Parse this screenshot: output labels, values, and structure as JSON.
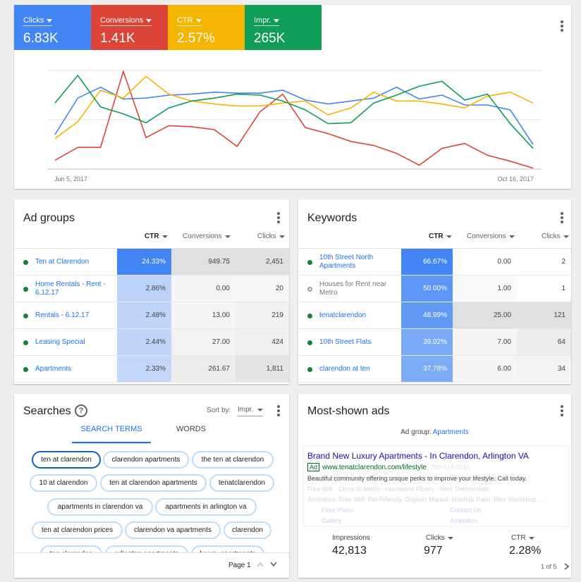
{
  "summary": {
    "metrics": [
      {
        "label": "Clicks",
        "value": "6.83K",
        "color": "#4285f4"
      },
      {
        "label": "Conversions",
        "value": "1.41K",
        "color": "#db4437"
      },
      {
        "label": "CTR",
        "value": "2.57%",
        "color": "#f4b400"
      },
      {
        "label": "Impr.",
        "value": "265K",
        "color": "#0f9d58"
      }
    ],
    "x_start": "Jun 5, 2017",
    "x_end": "Oct 16, 2017"
  },
  "chart_data": {
    "type": "line",
    "x": [
      "Jun 5, 2017",
      "",
      "",
      "",
      "",
      "",
      "",
      "",
      "",
      "",
      "",
      "",
      "",
      "",
      "",
      "",
      "",
      "",
      "",
      "",
      "",
      "Oct 16, 2017"
    ],
    "xlabel": "",
    "ylabel": "",
    "grid": true,
    "legend": "top (metric tiles)",
    "series": [
      {
        "name": "Clicks",
        "color": "#4285f4",
        "values": [
          0.35,
          0.72,
          0.83,
          0.71,
          0.72,
          0.75,
          0.76,
          0.78,
          0.77,
          0.77,
          0.8,
          0.7,
          0.66,
          0.69,
          0.72,
          0.83,
          0.71,
          0.75,
          0.65,
          0.65,
          0.6,
          0.25
        ]
      },
      {
        "name": "Conversions",
        "color": "#db4437",
        "values": [
          0.09,
          0.22,
          0.22,
          0.99,
          0.32,
          0.44,
          0.43,
          0.4,
          0.23,
          0.58,
          0.76,
          0.42,
          0.36,
          0.28,
          0.24,
          0.16,
          0.04,
          0.21,
          0.26,
          0.14,
          0.08,
          0.01
        ]
      },
      {
        "name": "CTR",
        "color": "#f4b400",
        "values": [
          0.31,
          0.48,
          0.8,
          0.72,
          0.94,
          0.76,
          0.69,
          0.66,
          0.64,
          0.64,
          0.67,
          0.69,
          0.55,
          0.62,
          0.78,
          0.69,
          0.69,
          0.66,
          0.62,
          0.74,
          0.78,
          0.67
        ]
      },
      {
        "name": "Impr.",
        "color": "#0f9d58",
        "values": [
          0.67,
          0.95,
          0.63,
          0.56,
          0.47,
          0.62,
          0.69,
          0.72,
          0.76,
          0.75,
          0.69,
          0.6,
          0.46,
          0.47,
          0.67,
          0.75,
          0.84,
          0.89,
          0.7,
          0.76,
          0.46,
          0.21
        ]
      }
    ]
  },
  "ad_groups": {
    "title": "Ad groups",
    "headers": {
      "ctr": "CTR",
      "conversions": "Conversions",
      "clicks": "Clicks"
    },
    "rows": [
      {
        "name": "Ten at Clarendon",
        "ctr": "24.33%",
        "conversions": "949.75",
        "clicks": "2,451",
        "status": "enabled"
      },
      {
        "name": "Home Rentals - Rent - 6.12.17",
        "ctr": "2.86%",
        "conversions": "0.00",
        "clicks": "20",
        "status": "enabled"
      },
      {
        "name": "Rentals - 6.12.17",
        "ctr": "2.48%",
        "conversions": "13.00",
        "clicks": "219",
        "status": "enabled"
      },
      {
        "name": "Leasing Special",
        "ctr": "2.44%",
        "conversions": "27.00",
        "clicks": "424",
        "status": "enabled"
      },
      {
        "name": "Apartments",
        "ctr": "2.33%",
        "conversions": "261.67",
        "clicks": "1,811",
        "status": "enabled"
      }
    ]
  },
  "keywords": {
    "title": "Keywords",
    "headers": {
      "ctr": "CTR",
      "conversions": "Conversions",
      "clicks": "Clicks"
    },
    "rows": [
      {
        "name": "10th Street North Apartments",
        "ctr": "66.67%",
        "conversions": "0.00",
        "clicks": "2",
        "status": "enabled"
      },
      {
        "name": "Houses for Rent near Metro",
        "ctr": "50.00%",
        "conversions": "1.00",
        "clicks": "1",
        "status": "paused"
      },
      {
        "name": "tenatclarendon",
        "ctr": "48.99%",
        "conversions": "25.00",
        "clicks": "121",
        "status": "enabled"
      },
      {
        "name": "10th Street Flats",
        "ctr": "39.02%",
        "conversions": "7.00",
        "clicks": "64",
        "status": "enabled"
      },
      {
        "name": "clarendon at ten",
        "ctr": "37.78%",
        "conversions": "6.00",
        "clicks": "34",
        "status": "enabled"
      }
    ]
  },
  "searches": {
    "title": "Searches",
    "help_icon": "?",
    "sort_label": "Sort by:",
    "sort_value": "Impr.",
    "tabs": [
      "SEARCH TERMS",
      "WORDS"
    ],
    "chips": [
      "ten at clarendon",
      "clarendon apartments",
      "the ten at clarendon",
      "10 at clarendon",
      "ten at clarendon apartments",
      "tenatclarendon",
      "apartments in clarendon va",
      "apartments in arlington va",
      "ten at clarendon prices",
      "clarendon va apartments",
      "clarendon",
      "ten clarendon",
      "arlington apartments",
      "luxury apartments"
    ],
    "page_label": "Page 1"
  },
  "ads": {
    "title": "Most-shown ads",
    "ad_group_label": "Ad group:",
    "ad_group_value": "Apartments",
    "headline": "Brand New Luxury Apartments - In Clarendon, Arlington VA",
    "ad_badge": "Ad",
    "url": "www.tenatclarendon.com/lifestyle",
    "phone": "703-516-0010",
    "description": "Beautiful community offering unique perks to improve your lifestyle. Call today.",
    "line2": "Free Wifi · Close to Metro · Hardwood Floors · Nest Thermostats",
    "line3": "Amenities: Free Wifi, Pet-Friendly, Organic Market, Rooftop Patio, Bike Workshop, ...",
    "sitelinks": [
      "Floor Plans",
      "Contact Us",
      "Gallery",
      "Amenities"
    ],
    "stats": [
      {
        "label": "Impressions",
        "value": "42,813"
      },
      {
        "label": "Clicks",
        "value": "977"
      },
      {
        "label": "CTR",
        "value": "2.28%"
      }
    ],
    "pager": "1 of 5"
  }
}
